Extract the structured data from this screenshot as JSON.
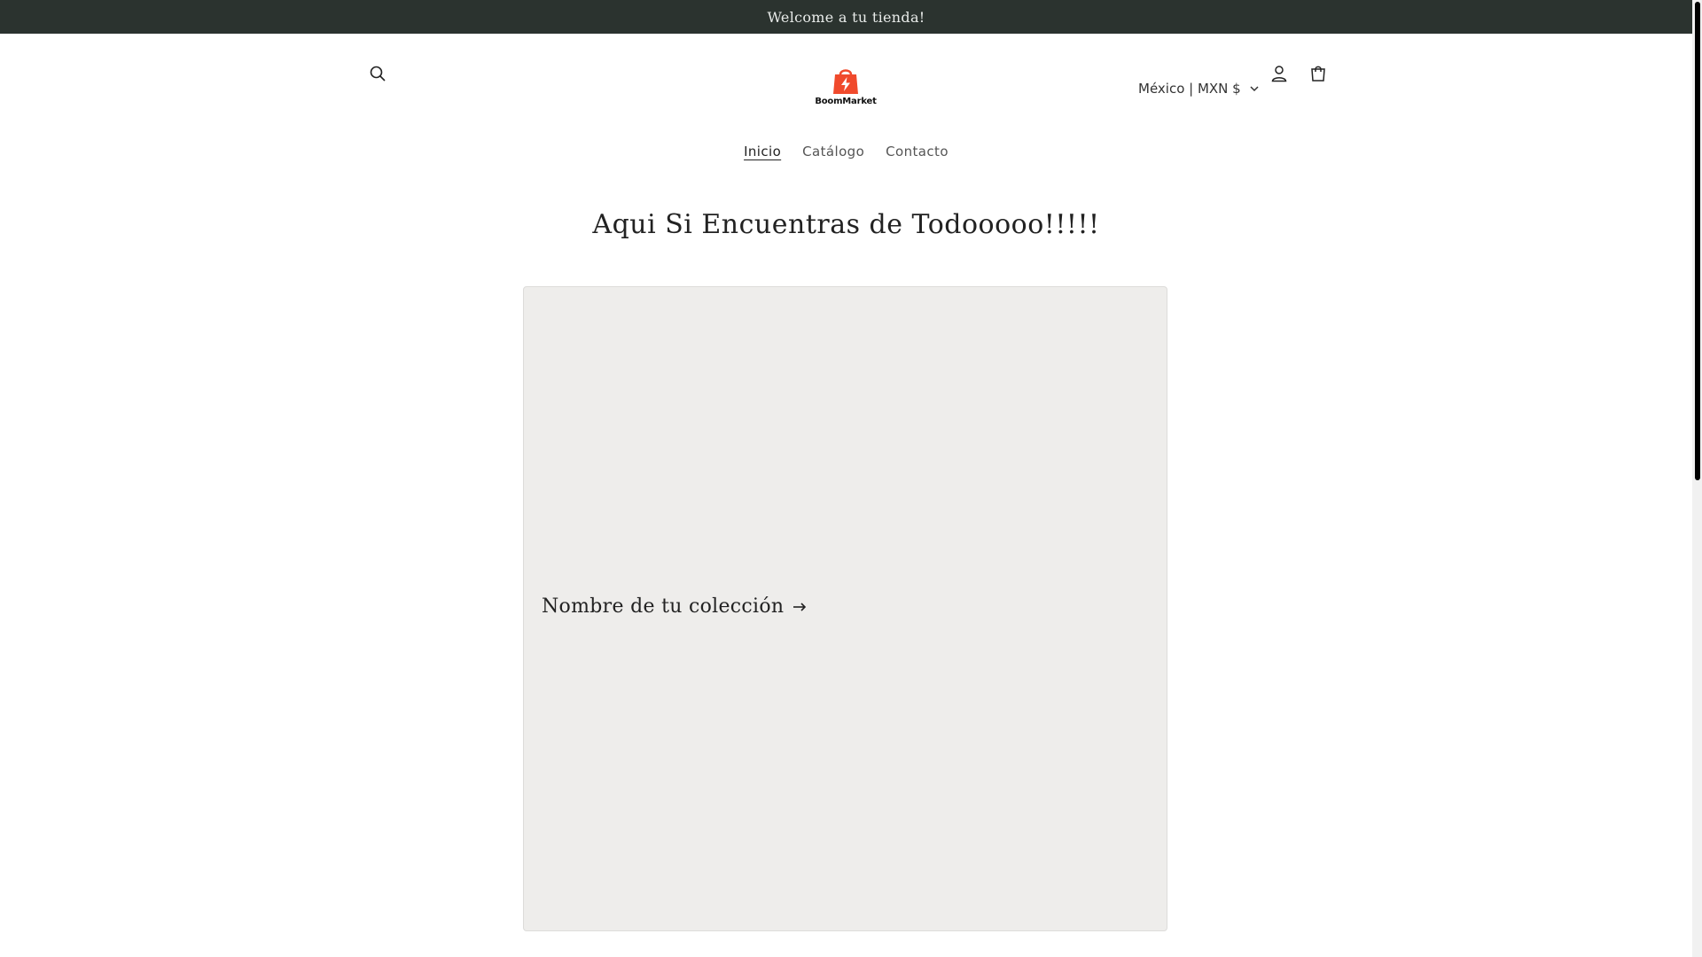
{
  "announcement": {
    "text": "Welcome a tu tienda!"
  },
  "header": {
    "logo_text": "BoomMarket",
    "logo_color": "#f04a2c",
    "country_selector": "México | MXN $"
  },
  "nav": {
    "items": [
      {
        "label": "Inicio",
        "active": true
      },
      {
        "label": "Catálogo",
        "active": false
      },
      {
        "label": "Contacto",
        "active": false
      }
    ]
  },
  "main": {
    "title": "Aqui Si Encuentras de Todooooo!!!!!",
    "collection": {
      "label": "Nombre de tu colección"
    }
  }
}
